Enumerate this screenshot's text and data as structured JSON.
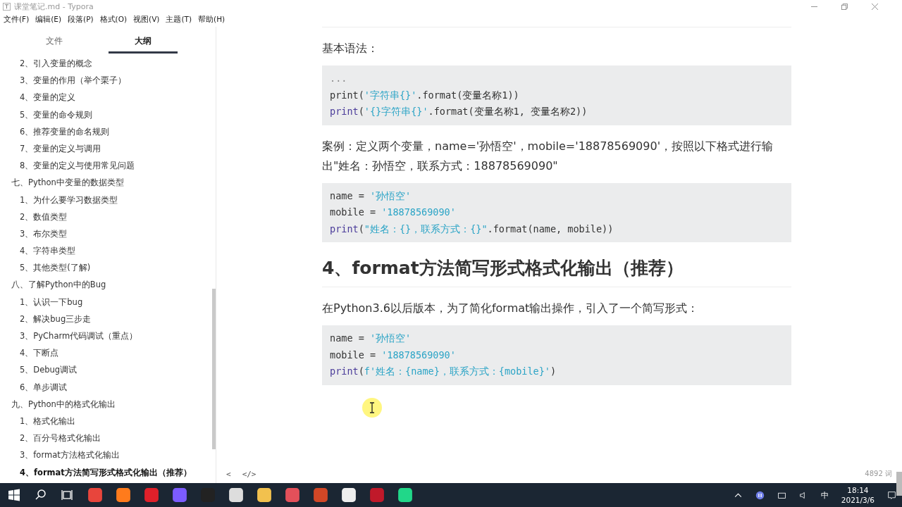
{
  "window": {
    "title": "课堂笔记.md - Typora"
  },
  "menu": [
    "文件(F)",
    "编辑(E)",
    "段落(P)",
    "格式(O)",
    "视图(V)",
    "主题(T)",
    "帮助(H)"
  ],
  "sidebar_tabs": [
    {
      "label": "文件",
      "selected": false
    },
    {
      "label": "大纲",
      "selected": true
    }
  ],
  "outline": {
    "leading_items": [
      {
        "label": "2、引入变量的概念",
        "selected": false
      },
      {
        "label": "3、变量的作用（举个栗子）",
        "selected": false
      },
      {
        "label": "4、变量的定义",
        "selected": false
      },
      {
        "label": "5、变量的命令规则",
        "selected": false
      },
      {
        "label": "6、推荐变量的命名规则",
        "selected": false
      },
      {
        "label": "7、变量的定义与调用",
        "selected": false
      },
      {
        "label": "8、变量的定义与使用常见问题",
        "selected": false
      }
    ],
    "sections": [
      {
        "label": "七、Python中变量的数据类型",
        "selected": false,
        "children": [
          {
            "label": "1、为什么要学习数据类型",
            "selected": false
          },
          {
            "label": "2、数值类型",
            "selected": false
          },
          {
            "label": "3、布尔类型",
            "selected": false
          },
          {
            "label": "4、字符串类型",
            "selected": false
          },
          {
            "label": "5、其他类型(了解)",
            "selected": false
          }
        ]
      },
      {
        "label": "八、了解Python中的Bug",
        "selected": false,
        "children": [
          {
            "label": "1、认识一下bug",
            "selected": false
          },
          {
            "label": "2、解决bug三步走",
            "selected": false
          },
          {
            "label": "3、PyCharm代码调试（重点）",
            "selected": false
          },
          {
            "label": "4、下断点",
            "selected": false
          },
          {
            "label": "5、Debug调试",
            "selected": false
          },
          {
            "label": "6、单步调试",
            "selected": false
          }
        ]
      },
      {
        "label": "九、Python中的格式化输出",
        "selected": false,
        "children": [
          {
            "label": "1、格式化输出",
            "selected": false
          },
          {
            "label": "2、百分号格式化输出",
            "selected": false
          },
          {
            "label": "3、format方法格式化输出",
            "selected": false
          },
          {
            "label": "4、format方法简写形式格式化输出（推荐）",
            "selected": true
          }
        ]
      }
    ]
  },
  "document": [
    {
      "kind": "paragraph",
      "text": "基本语法："
    },
    {
      "kind": "code",
      "lines": [
        [
          {
            "kind": "comment",
            "text": "..."
          }
        ],
        [
          {
            "kind": "plain",
            "text": "print("
          },
          {
            "kind": "string",
            "text": "'字符串{}'"
          },
          {
            "kind": "plain",
            "text": ".format(变量名称1))"
          }
        ],
        [
          {
            "kind": "keyword",
            "text": "print"
          },
          {
            "kind": "plain",
            "text": "("
          },
          {
            "kind": "string",
            "text": "'{}字符串{}'"
          },
          {
            "kind": "plain",
            "text": ".format(变量名称1, 变量名称2))"
          }
        ]
      ]
    },
    {
      "kind": "paragraph",
      "text": "案例：定义两个变量，name='孙悟空'，mobile='18878569090'，按照以下格式进行输出\"姓名：孙悟空，联系方式：18878569090\""
    },
    {
      "kind": "code",
      "lines": [
        [
          {
            "kind": "plain",
            "text": "name = "
          },
          {
            "kind": "string",
            "text": "'孙悟空'"
          }
        ],
        [
          {
            "kind": "plain",
            "text": "mobile = "
          },
          {
            "kind": "string",
            "text": "'18878569090'"
          }
        ],
        [
          {
            "kind": "keyword",
            "text": "print"
          },
          {
            "kind": "plain",
            "text": "("
          },
          {
            "kind": "string",
            "text": "\"姓名：{}，联系方式：{}\""
          },
          {
            "kind": "plain",
            "text": ".format(name, mobile))"
          }
        ]
      ]
    },
    {
      "kind": "heading",
      "text": "4、format方法简写形式格式化输出（推荐）"
    },
    {
      "kind": "paragraph",
      "text": "在Python3.6以后版本，为了简化format输出操作，引入了一个简写形式："
    },
    {
      "kind": "code",
      "lines": [
        [
          {
            "kind": "plain",
            "text": "name = "
          },
          {
            "kind": "string",
            "text": "'孙悟空'"
          }
        ],
        [
          {
            "kind": "plain",
            "text": "mobile = "
          },
          {
            "kind": "string",
            "text": "'18878569090'"
          }
        ],
        [
          {
            "kind": "keyword",
            "text": "print"
          },
          {
            "kind": "plain",
            "text": "("
          },
          {
            "kind": "string",
            "text": "f'姓名：{name}，联系方式：{mobile}'"
          },
          {
            "kind": "plain",
            "text": ")"
          }
        ]
      ]
    }
  ],
  "footer": {
    "back": "<",
    "source": "</>",
    "word_count": "4892 词"
  },
  "taskbar": {
    "tray": "中",
    "time": "18:14",
    "date": "2021/3/6"
  }
}
